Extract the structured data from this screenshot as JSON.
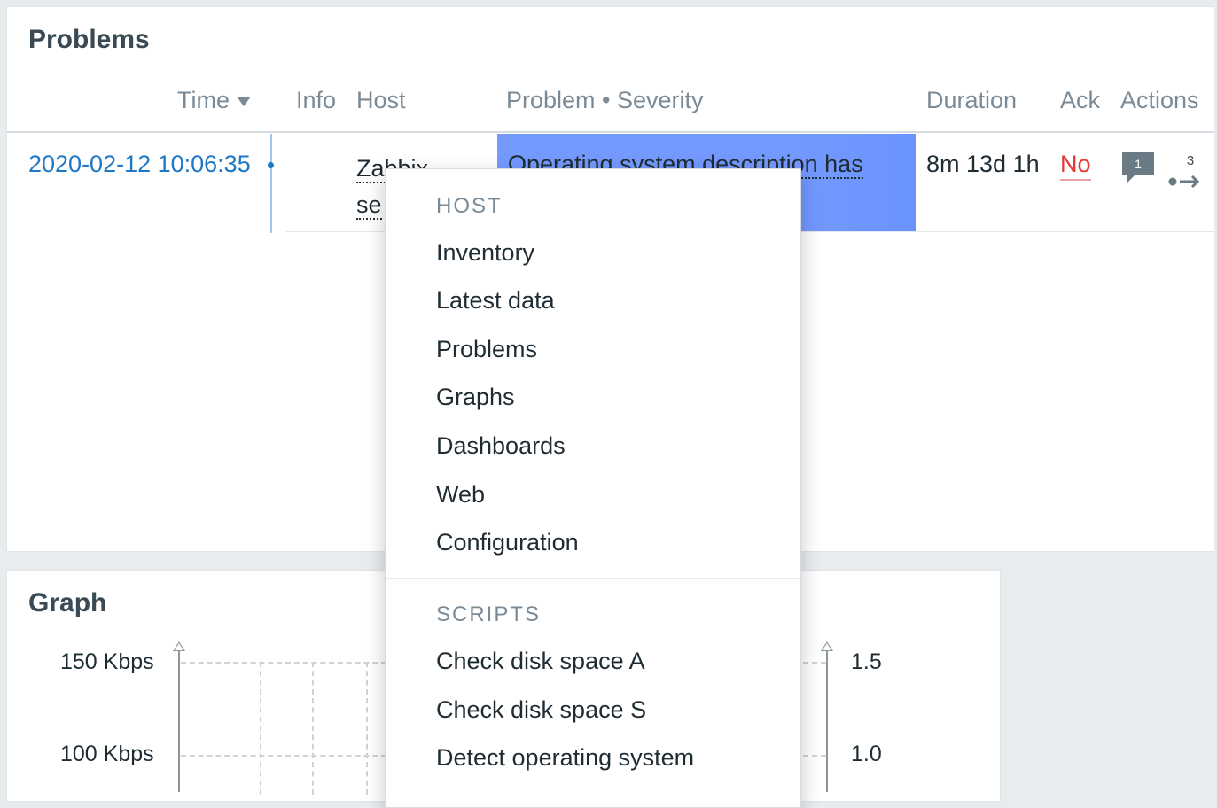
{
  "problems": {
    "title": "Problems",
    "columns": {
      "time": "Time",
      "info": "Info",
      "host": "Host",
      "problem_severity": "Problem • Severity",
      "duration": "Duration",
      "ack": "Ack",
      "actions": "Actions"
    },
    "row": {
      "time": "2020-02-12 10:06:35",
      "host_line1": "Zabbix",
      "host_line2": "se",
      "problem": "Operating system description has",
      "duration": "8m 13d 1h",
      "ack": "No",
      "messages_count": "1",
      "actions_count": "3",
      "severity_color": "#7499ff"
    }
  },
  "graph": {
    "title": "Graph",
    "y_left_labels": [
      "150 Kbps",
      "100 Kbps"
    ],
    "y_right_labels": [
      "1.5",
      "1.0"
    ]
  },
  "menu": {
    "host_header": "HOST",
    "host_items": [
      "Inventory",
      "Latest data",
      "Problems",
      "Graphs",
      "Dashboards",
      "Web",
      "Configuration"
    ],
    "scripts_header": "SCRIPTS",
    "script_items": [
      "Check disk space A",
      "Check disk space S",
      "Detect operating system"
    ]
  },
  "colors": {
    "link": "#1e78c8",
    "ack_no": "#e33734",
    "severity_info": "#7499ff"
  }
}
